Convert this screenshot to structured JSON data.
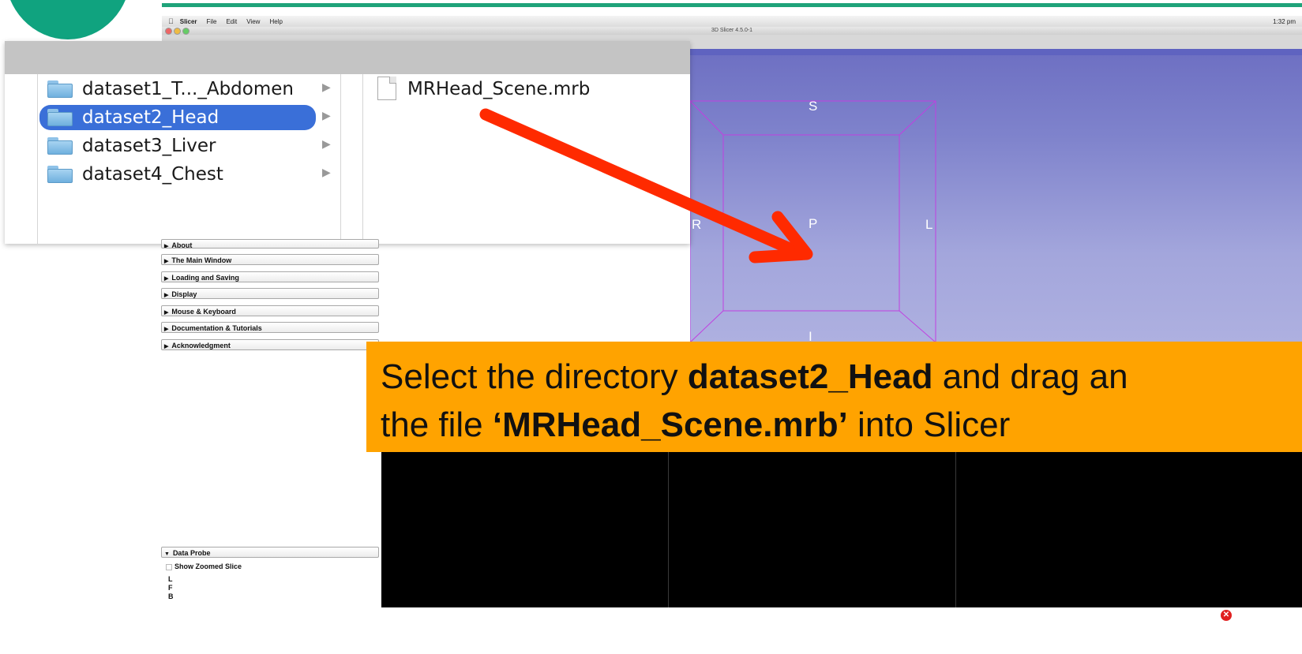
{
  "menubar": {
    "apple": "",
    "app": "Slicer",
    "items": [
      "File",
      "Edit",
      "View",
      "Help"
    ],
    "status": "1:32 pm"
  },
  "window": {
    "title": "3D Slicer 4.5.0-1"
  },
  "finder": {
    "folders": [
      {
        "label": "dataset1_T..._Abdomen",
        "selected": false
      },
      {
        "label": "dataset2_Head",
        "selected": true
      },
      {
        "label": "dataset3_Liver",
        "selected": false
      },
      {
        "label": "dataset4_Chest",
        "selected": false
      }
    ],
    "file": "MRHead_Scene.mrb"
  },
  "view3d": {
    "labels": {
      "superior": "S",
      "posterior": "P",
      "right": "R",
      "left": "L",
      "inferior": "I"
    }
  },
  "modules": {
    "sections": [
      "About",
      "The Main Window",
      "Loading and Saving",
      "Display",
      "Mouse & Keyboard",
      "Documentation & Tutorials",
      "Acknowledgment"
    ]
  },
  "data_probe": {
    "title": "Data Probe",
    "option": "Show Zoomed Slice",
    "letters": [
      "L",
      "F",
      "B"
    ]
  },
  "instruction": {
    "line1_pre": "Select the directory ",
    "line1_bold": "dataset2_Head",
    "line1_post": " and drag an",
    "line2_pre": "the file ",
    "line2_bold": "‘MRHead_Scene.mrb’",
    "line2_post": " into Slicer"
  },
  "colors": {
    "arrow": "#ff2a00",
    "banner": "#ffa300",
    "selection": "#3a6fd8",
    "view3d_box": "#c040e0"
  }
}
